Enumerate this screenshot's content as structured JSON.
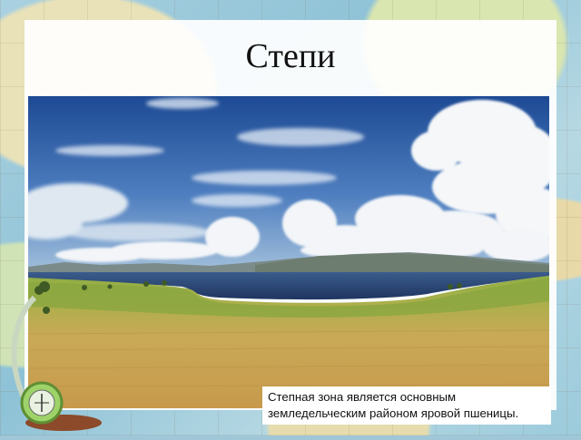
{
  "slide": {
    "title": "Степи",
    "caption": "Степная зона является основным земледельческим районом яровой пшеницы."
  },
  "photo": {
    "subject": "steppe-landscape-photo",
    "colors": {
      "sky_top": "#1e4f9a",
      "sky_bottom": "#8fb6d8",
      "cloud": "#f4f6f8",
      "lake": "#27406a",
      "hills": "#7a8a86",
      "grass_green": "#8aa640",
      "grass_gold": "#c8a454"
    }
  },
  "decoration": {
    "icon": "globe-compass-icon"
  }
}
